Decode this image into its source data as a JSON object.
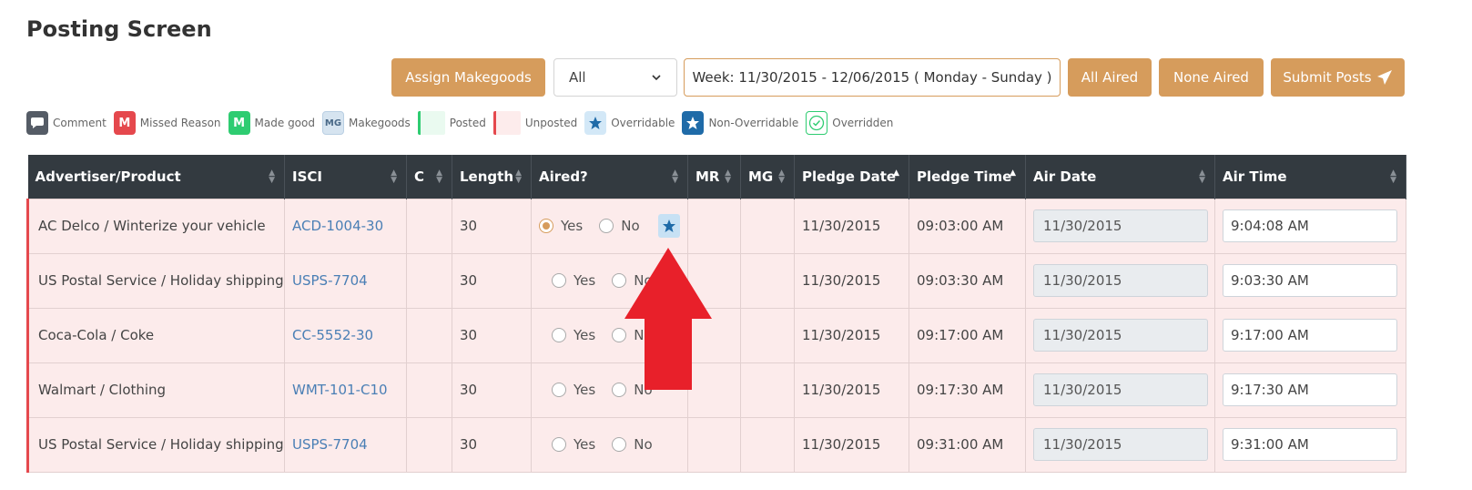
{
  "page": {
    "title": "Posting Screen"
  },
  "toolbar": {
    "assign_makegoods": "Assign Makegoods",
    "filter_value": "All",
    "week_range": "Week: 11/30/2015 - 12/06/2015 ( Monday - Sunday )",
    "all_aired": "All Aired",
    "none_aired": "None Aired",
    "submit_posts": "Submit Posts"
  },
  "legend": {
    "comment": "Comment",
    "missed_reason_glyph": "M",
    "missed_reason": "Missed Reason",
    "made_good_glyph": "M",
    "made_good": "Made good",
    "makegoods_glyph": "MG",
    "makegoods": "Makegoods",
    "posted": "Posted",
    "unposted": "Unposted",
    "overridable": "Overridable",
    "non_overridable": "Non-Overridable",
    "overridden": "Overridden"
  },
  "table": {
    "columns": [
      "Advertiser/Product",
      "ISCI",
      "C",
      "Length",
      "Aired?",
      "MR",
      "MG",
      "Pledge Date",
      "Pledge Time",
      "Air Date",
      "Air Time"
    ],
    "yes_label": "Yes",
    "no_label": "No",
    "rows": [
      {
        "advertiser": "AC Delco / Winterize your vehicle",
        "isci": "ACD-1004-30",
        "c": "",
        "length": "30",
        "aired": "yes",
        "pledge_date": "11/30/2015",
        "pledge_time": "09:03:00 AM",
        "air_date": "11/30/2015",
        "air_time": "9:04:08 AM"
      },
      {
        "advertiser": "US Postal Service / Holiday shipping",
        "isci": "USPS-7704",
        "c": "",
        "length": "30",
        "aired": "",
        "pledge_date": "11/30/2015",
        "pledge_time": "09:03:30 AM",
        "air_date": "11/30/2015",
        "air_time": "9:03:30 AM"
      },
      {
        "advertiser": "Coca-Cola / Coke",
        "isci": "CC-5552-30",
        "c": "",
        "length": "30",
        "aired": "",
        "pledge_date": "11/30/2015",
        "pledge_time": "09:17:00 AM",
        "air_date": "11/30/2015",
        "air_time": "9:17:00 AM"
      },
      {
        "advertiser": "Walmart / Clothing",
        "isci": "WMT-101-C10",
        "c": "",
        "length": "30",
        "aired": "",
        "pledge_date": "11/30/2015",
        "pledge_time": "09:17:30 AM",
        "air_date": "11/30/2015",
        "air_time": "9:17:30 AM"
      },
      {
        "advertiser": "US Postal Service / Holiday shipping",
        "isci": "USPS-7704",
        "c": "",
        "length": "30",
        "aired": "",
        "pledge_date": "11/30/2015",
        "pledge_time": "09:31:00 AM",
        "air_date": "11/30/2015",
        "air_time": "9:31:00 AM"
      }
    ]
  },
  "colors": {
    "accent": "#d69c5c",
    "header_bg": "#333a40",
    "unposted_row": "#fcebeb",
    "arrow": "#e8202a"
  },
  "icons": {
    "comment": "speech-bubble-icon",
    "overridable": "star-icon",
    "overridden": "check-circle-icon",
    "submit": "paper-plane-icon"
  }
}
